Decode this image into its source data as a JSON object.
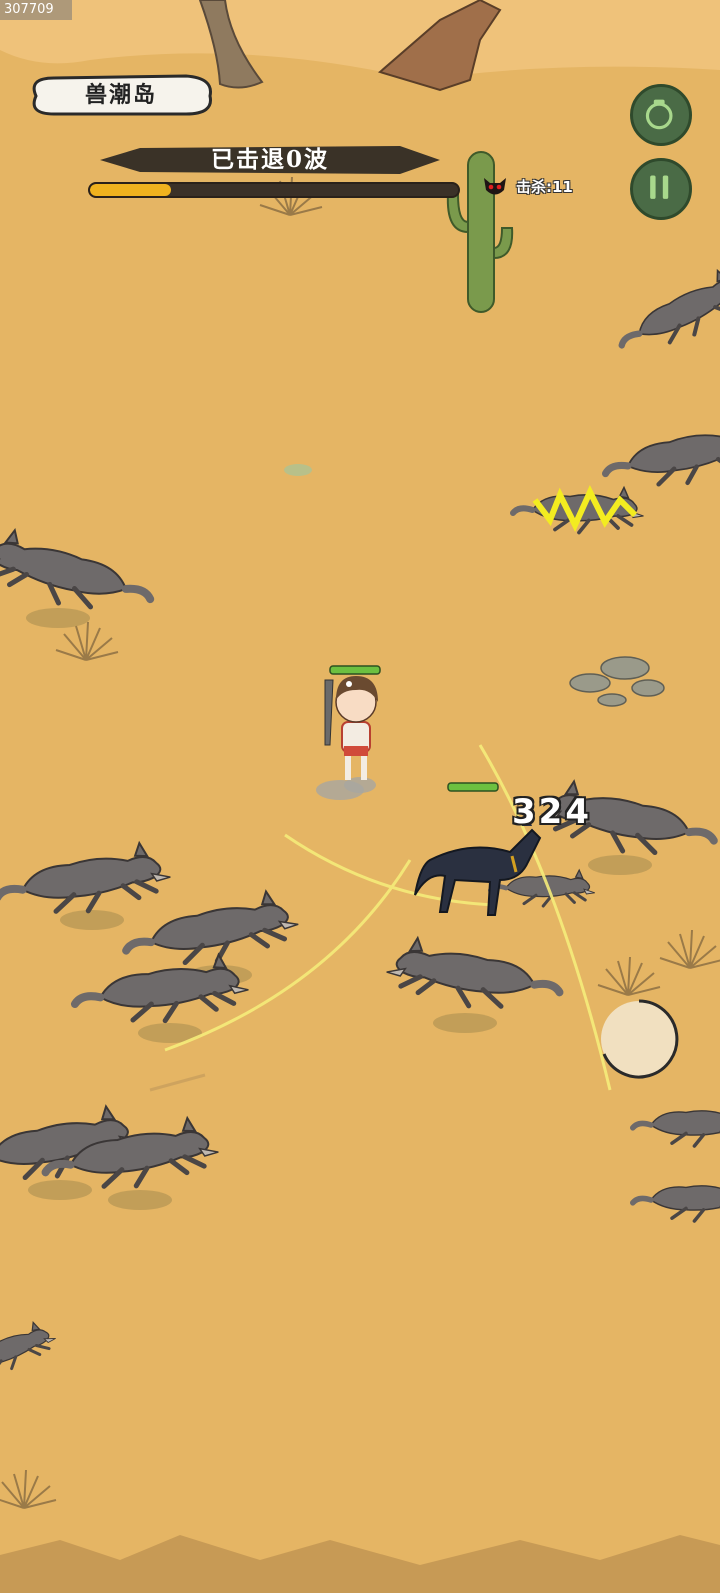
{
  "build_id": "307709",
  "map_name": "兽潮岛",
  "wave_text": "已击退0波",
  "wave_progress": 0.22,
  "kill_label": "击杀:11",
  "damage_number": "324",
  "buttons": {
    "potion_icon": "potion-bottle-icon",
    "pause_icon": "pause-icon",
    "skill_icon": "skill-joystick-icon"
  },
  "colors": {
    "sand": "#e5b564",
    "button_green": "#4a6b46",
    "progress_fill": "#f0b21e",
    "hp_bar": "#6cc040"
  }
}
